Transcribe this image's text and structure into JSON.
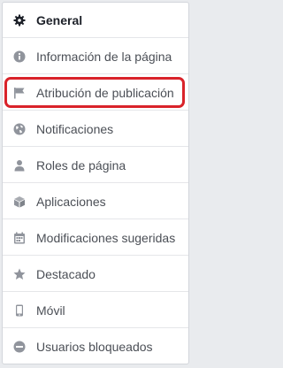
{
  "menu": {
    "items": [
      {
        "label": "General",
        "icon": "gear-icon",
        "active": true
      },
      {
        "label": "Información de la página",
        "icon": "info-icon"
      },
      {
        "label": "Atribución de publicación",
        "icon": "flag-icon"
      },
      {
        "label": "Notificaciones",
        "icon": "globe-icon"
      },
      {
        "label": "Roles de página",
        "icon": "person-icon"
      },
      {
        "label": "Aplicaciones",
        "icon": "cube-icon"
      },
      {
        "label": "Modificaciones sugeridas",
        "icon": "calendar-icon"
      },
      {
        "label": "Destacado",
        "icon": "star-icon"
      },
      {
        "label": "Móvil",
        "icon": "mobile-icon"
      },
      {
        "label": "Usuarios bloqueados",
        "icon": "blocked-icon"
      }
    ]
  },
  "colors": {
    "highlight": "#d9232a",
    "icon": "#90949c",
    "text": "#4b4f56"
  }
}
